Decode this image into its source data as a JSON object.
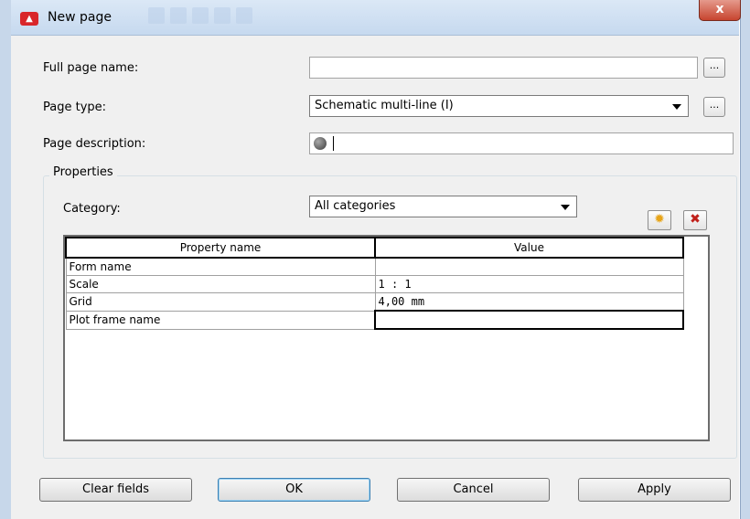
{
  "window": {
    "title": "New page",
    "close_label": "x"
  },
  "form": {
    "full_page_name": {
      "label": "Full page name:",
      "value": "",
      "browse_label": "..."
    },
    "page_type": {
      "label": "Page type:",
      "value": "Schematic multi-line (I)",
      "browse_label": "..."
    },
    "page_description": {
      "label": "Page description:",
      "value": "",
      "icon": "globe-icon"
    }
  },
  "properties": {
    "group_title": "Properties",
    "category": {
      "label": "Category:",
      "value": "All categories"
    },
    "new_icon": "star-icon",
    "delete_icon": "delete-x-icon",
    "columns": [
      "Property name",
      "Value"
    ],
    "rows": [
      {
        "name": "Form name",
        "value": ""
      },
      {
        "name": "Scale",
        "value": "1 : 1"
      },
      {
        "name": "Grid",
        "value": "4,00 mm"
      },
      {
        "name": "Plot frame name",
        "value": ""
      }
    ]
  },
  "buttons": {
    "clear_fields": "Clear fields",
    "ok": "OK",
    "cancel": "Cancel",
    "apply": "Apply"
  },
  "colors": {
    "titlebar": "#c6d9ef",
    "dialog_bg": "#f0f0f0",
    "close_red": "#c7442f",
    "app_icon_red": "#d9262a"
  }
}
